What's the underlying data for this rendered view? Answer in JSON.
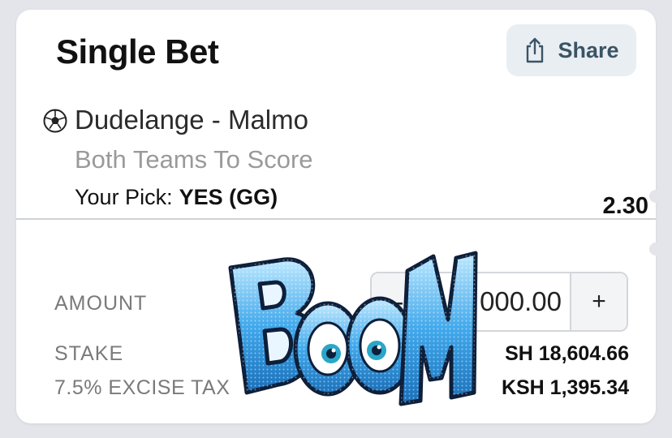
{
  "header": {
    "title": "Single Bet",
    "share_label": "Share",
    "share_icon": "share-icon"
  },
  "bet": {
    "sport_icon": "soccer-ball-icon",
    "match": "Dudelange - Malmo",
    "market": "Both Teams To Score",
    "pick_label": "Your Pick:",
    "pick_value": "YES (GG)",
    "odds": "2.30"
  },
  "amount": {
    "label": "AMOUNT",
    "minus": "-",
    "value": "000.00",
    "plus": "+"
  },
  "summary": {
    "stake_label": "STAKE",
    "stake_value": "SH 18,604.66",
    "tax_label": "7.5% EXCISE TAX",
    "tax_value": "KSH 1,395.34"
  },
  "overlay": {
    "sticker": "boom-sticker",
    "text": "BOOM"
  },
  "colors": {
    "background": "#e3e5ea",
    "card": "#ffffff",
    "share_bg": "#e9eef2",
    "share_text": "#3a5466",
    "boom_blue": "#2a8fd6"
  }
}
